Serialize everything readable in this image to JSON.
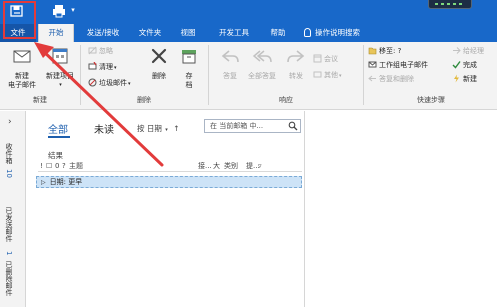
{
  "tabs": [
    {
      "label": "文件"
    },
    {
      "label": "开始"
    },
    {
      "label": "发送/接收"
    },
    {
      "label": "文件夹"
    },
    {
      "label": "视图"
    },
    {
      "label": "开发工具"
    },
    {
      "label": "帮助"
    },
    {
      "label": "操作说明搜索"
    }
  ],
  "ribbon": {
    "new_group": {
      "label": "新建",
      "new_email_line1": "新建",
      "new_email_line2": "电子邮件",
      "new_items_line1": "新建项目"
    },
    "delete_group": {
      "label": "删除",
      "ignore": "忽略",
      "clean_up": "清理",
      "junk": "垃圾邮件",
      "delete": "删除",
      "archive": "存",
      "archive_line2": "档"
    },
    "respond_group": {
      "label": "响应",
      "reply": "答复",
      "reply_all": "全部答复",
      "forward": "转发",
      "meeting": "会议",
      "more": "其他"
    },
    "quick_steps_group": {
      "label": "快速步骤",
      "move_to": "移至: ?",
      "team_email": "工作组电子邮件",
      "reply_delete": "答复和删除",
      "manager": "给经理",
      "done": "完成",
      "create_new": "新建"
    }
  },
  "nav": {
    "inbox_label": "收件箱",
    "inbox_count": "10",
    "sent_label": "已发送邮件",
    "deleted_label": "已删除邮件",
    "deleted_count": "1"
  },
  "mail_list": {
    "filter_all": "全部",
    "filter_unread": "未读",
    "sort_label": "按 日期",
    "sort_arrow": "↑",
    "search_placeholder": "在 当前邮箱 中...",
    "results_label": "结果",
    "columns": {
      "importance": "!",
      "icon": "☐",
      "attachment": "0",
      "from": "?",
      "subject": "主题",
      "received": "接...",
      "size": "大",
      "category": "类别",
      "flag": "提..."
    },
    "group_row": "日期: 更早"
  },
  "colors": {
    "brand": "#1868c9",
    "annotation": "#e23b3b",
    "selection": "#cde3f7"
  }
}
